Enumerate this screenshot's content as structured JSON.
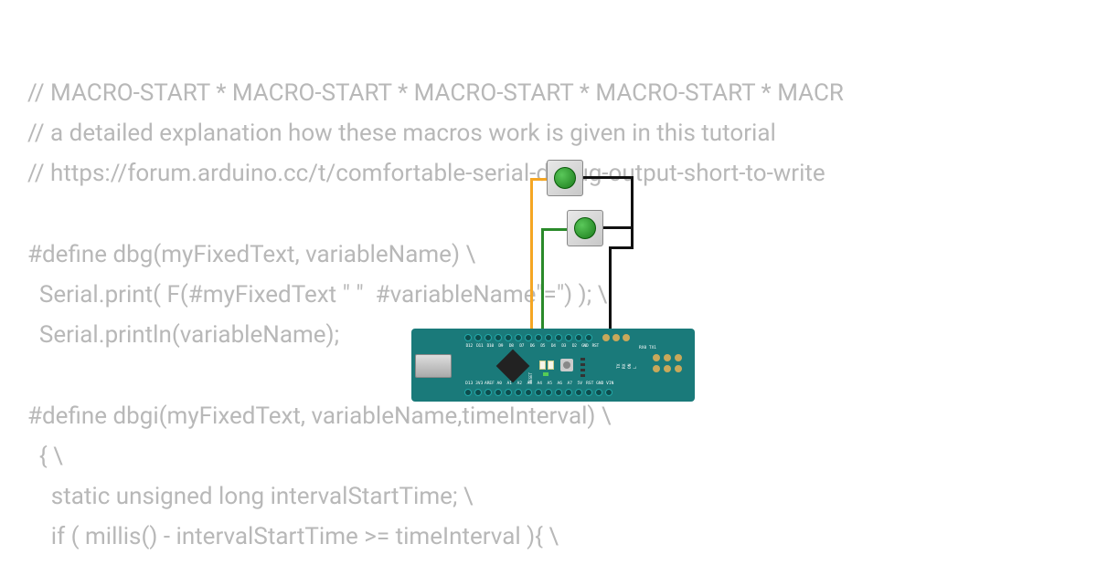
{
  "code": {
    "line1": "// MACRO-START * MACRO-START * MACRO-START * MACRO-START * MACR",
    "line2": "// a detailed explanation how these macros work is given in this tutorial",
    "line3": "// https://forum.arduino.cc/t/comfortable-serial-debug-output-short-to-write",
    "line4": "",
    "line5": "#define dbg(myFixedText, variableName) \\",
    "line6": "  Serial.print( F(#myFixedText \" \"  #variableName\"=\") ); \\",
    "line7": "  Serial.println(variableName);",
    "line8": "",
    "line9": "#define dbgi(myFixedText, variableName,timeInterval) \\",
    "line10": "  { \\",
    "line11": "    static unsigned long intervalStartTime; \\",
    "line12": "    if ( millis() - intervalStartTime >= timeInterval ){ \\"
  },
  "board": {
    "name": "Arduino Nano",
    "top_pins": [
      "D12",
      "D11",
      "D10",
      "D9",
      "D8",
      "D7",
      "D6",
      "D5",
      "D4",
      "D3",
      "D2",
      "GND",
      "RST"
    ],
    "bottom_pins": [
      "D13",
      "3V3",
      "AREF",
      "A0",
      "A1",
      "A2",
      "A3",
      "A4",
      "A5",
      "A6",
      "A7",
      "5V",
      "RST",
      "GND",
      "VIN"
    ],
    "vert": [
      "TX",
      "RX",
      "ON",
      "L"
    ],
    "rxtx": "RX0 TX1",
    "reset": "RESET"
  },
  "components": {
    "button1": "pushbutton-green",
    "button2": "pushbutton-green"
  },
  "wires": {
    "orange": "D7",
    "green": "D6",
    "black": "GND"
  }
}
